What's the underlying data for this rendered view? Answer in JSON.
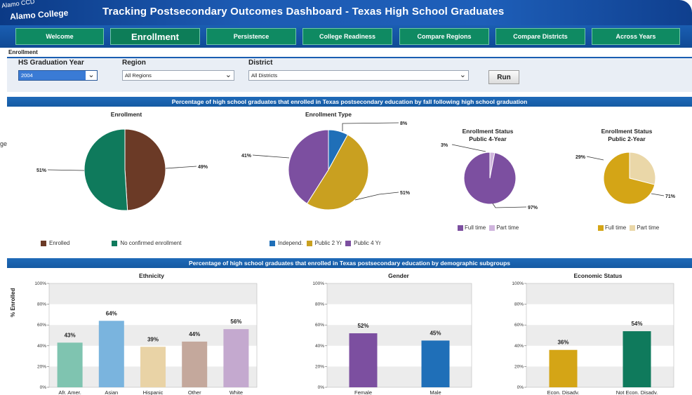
{
  "brand": {
    "top": "Alamo CCD",
    "main": "Alamo College",
    "side": "ge"
  },
  "header": {
    "title": "Tracking Postsecondary Outcomes Dashboard - Texas High School Graduates"
  },
  "tabs": [
    {
      "label": "Welcome"
    },
    {
      "label": "Enrollment"
    },
    {
      "label": "Persistence"
    },
    {
      "label": "College Readiness"
    },
    {
      "label": "Compare Regions"
    },
    {
      "label": "Compare Districts"
    },
    {
      "label": "Across Years"
    }
  ],
  "breadcrumb": "Enrollment",
  "filters": {
    "year_label": "HS Graduation Year",
    "year_value": "2004",
    "region_label": "Region",
    "region_value": "All Regions",
    "district_label": "District",
    "district_value": "All Districts",
    "run_label": "Run"
  },
  "section1_title": "Percentage of high school graduates that enrolled in Texas postsecondary education by fall following high school graduation",
  "section2_title": "Percentage of high school graduates that enrolled in Texas postsecondary education by demographic subgroups",
  "colors": {
    "enrolled": "#6b3a26",
    "no_enroll": "#0f7a5c",
    "independent": "#1f6fb8",
    "public2": "#c9a020",
    "public4": "#7c4fa0",
    "fulltime4": "#7c4fa0",
    "parttime4": "#cfb4dd",
    "fulltime2": "#d4a516",
    "parttime2": "#ead7a8",
    "eth": [
      "#7fc4b0",
      "#7ab4de",
      "#e9d3a6",
      "#c4a89c",
      "#c4a9cf"
    ],
    "gender": [
      "#7c4fa0",
      "#1f6fb8"
    ],
    "econ": [
      "#d4a516",
      "#0f7a5c"
    ]
  },
  "chart_data": [
    {
      "type": "pie",
      "title": "Enrollment",
      "categories": [
        "Enrolled",
        "No confirmed enrollment"
      ],
      "values": [
        49,
        51
      ],
      "labels": [
        "49%",
        "51%"
      ]
    },
    {
      "type": "pie",
      "title": "Enrollment Type",
      "categories": [
        "Independ.",
        "Public 2 Yr",
        "Public 4 Yr"
      ],
      "values": [
        8,
        51,
        41
      ],
      "labels": [
        "8%",
        "51%",
        "41%"
      ]
    },
    {
      "type": "pie",
      "title": "Enrollment Status Public 4-Year",
      "title_lines": [
        "Enrollment Status",
        "Public 4-Year"
      ],
      "categories": [
        "Full time",
        "Part time"
      ],
      "values": [
        97,
        3
      ],
      "labels": [
        "97%",
        "3%"
      ]
    },
    {
      "type": "pie",
      "title": "Enrollment Status Public 2-Year",
      "title_lines": [
        "Enrollment Status",
        "Public 2-Year"
      ],
      "categories": [
        "Full time",
        "Part time"
      ],
      "values": [
        71,
        29
      ],
      "labels": [
        "71%",
        "29%"
      ]
    },
    {
      "type": "bar",
      "title": "Ethnicity",
      "ylabel": "% Enrolled",
      "categories": [
        "Afr. Amer.",
        "Asian",
        "Hispanic",
        "Other",
        "White"
      ],
      "values": [
        43,
        64,
        39,
        44,
        56
      ],
      "labels": [
        "43%",
        "64%",
        "39%",
        "44%",
        "56%"
      ],
      "ylim": [
        0,
        100
      ],
      "yticks": [
        "0%",
        "20%",
        "40%",
        "60%",
        "80%",
        "100%"
      ]
    },
    {
      "type": "bar",
      "title": "Gender",
      "categories": [
        "Female",
        "Male"
      ],
      "values": [
        52,
        45
      ],
      "labels": [
        "52%",
        "45%"
      ],
      "ylim": [
        0,
        100
      ],
      "yticks": [
        "0%",
        "20%",
        "40%",
        "60%",
        "80%",
        "100%"
      ]
    },
    {
      "type": "bar",
      "title": "Economic Status",
      "categories": [
        "Econ. Disadv.",
        "Not Econ. Disadv."
      ],
      "values": [
        36,
        54
      ],
      "labels": [
        "36%",
        "54%"
      ],
      "ylim": [
        0,
        100
      ],
      "yticks": [
        "0%",
        "20%",
        "40%",
        "60%",
        "80%",
        "100%"
      ]
    }
  ]
}
